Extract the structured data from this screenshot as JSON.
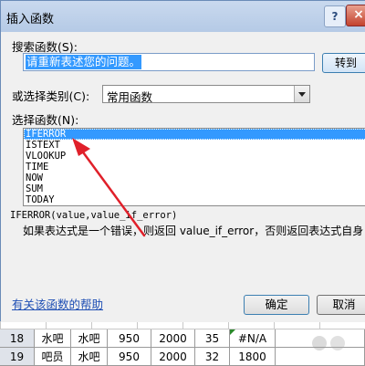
{
  "dialog": {
    "title": "插入函数",
    "help_symbol": "?",
    "close_symbol": "×"
  },
  "search": {
    "label": "搜索函数(S):",
    "value": "请重新表述您的问题。",
    "go_button": "转到"
  },
  "category": {
    "label": "或选择类别(C):",
    "selected": "常用函数"
  },
  "function_list": {
    "label": "选择函数(N):",
    "items": [
      "IFERROR",
      "ISTEXT",
      "VLOOKUP",
      "TIME",
      "NOW",
      "SUM",
      "TODAY"
    ],
    "selected_index": 0
  },
  "syntax": "IFERROR(value,value_if_error)",
  "description": "如果表达式是一个错误，则返回 value_if_error，否则返回表达式自身",
  "footer": {
    "help_link": "有关该函数的帮助",
    "ok": "确定",
    "cancel": "取消"
  },
  "sheet": {
    "rows": [
      {
        "num": "18",
        "a": "水吧",
        "b": "水吧",
        "c": "950",
        "d": "2000",
        "e": "35",
        "f": "#N/A"
      },
      {
        "num": "19",
        "a": "吧员",
        "b": "水吧",
        "c": "950",
        "d": "2000",
        "e": "32",
        "f": "1800"
      }
    ]
  },
  "colors": {
    "selection": "#3399ff",
    "arrow": "#e0202a",
    "link": "#1f4fb4"
  }
}
